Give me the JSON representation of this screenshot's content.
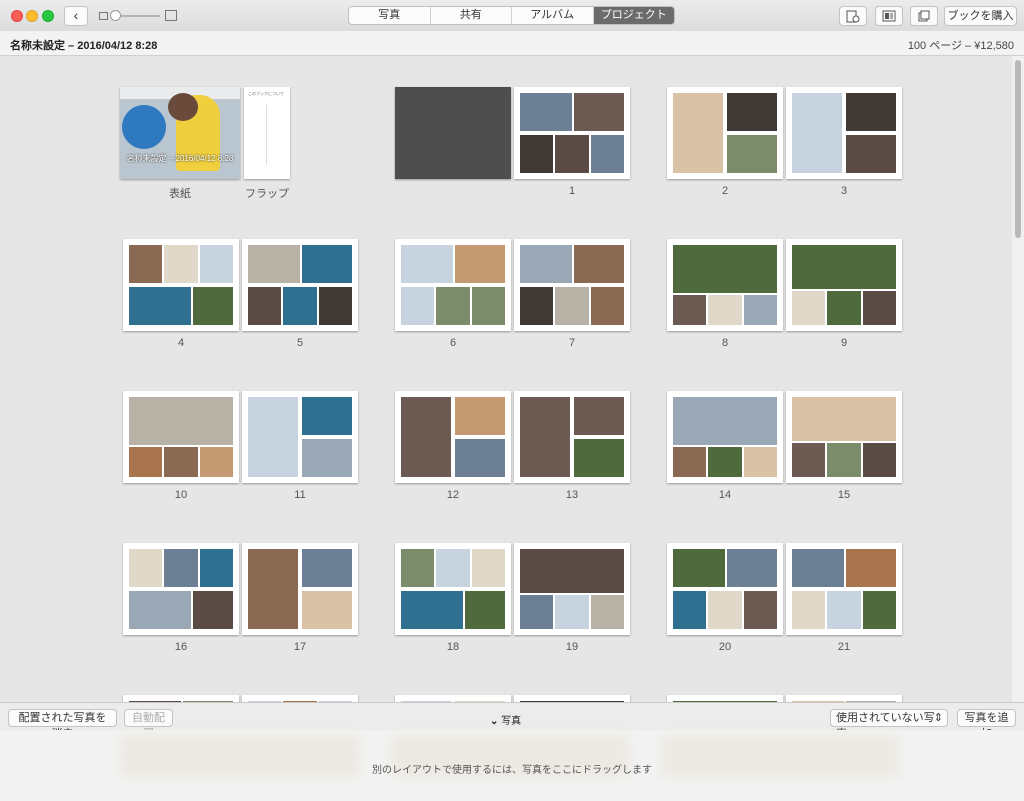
{
  "toolbar": {
    "tabs": [
      "写真",
      "共有",
      "アルバム",
      "プロジェクト"
    ],
    "active_tab": "プロジェクト",
    "buy_button": "ブックを購入"
  },
  "info": {
    "title": "名称未設定 – 2016/04/12 8:28",
    "summary": "100 ページ – ¥12,580"
  },
  "cover": {
    "caption": "名称未設定 – 2016/04/12 8:28",
    "flap_title": "このブックについて",
    "cover_label": "表紙",
    "flap_label": "フラップ"
  },
  "pages": [
    "1",
    "2",
    "3",
    "4",
    "5",
    "6",
    "7",
    "8",
    "9",
    "10",
    "11",
    "12",
    "13",
    "14",
    "15",
    "16",
    "17",
    "18",
    "19",
    "20",
    "21"
  ],
  "bottom": {
    "clear_button": "配置された写真を消去",
    "auto_button": "自動配置",
    "photos_toggle": "写真",
    "unused_select": "使用されていない写真",
    "add_button": "写真を追加",
    "drop_hint": "別のレイアウトで使用するには、写真をここにドラッグします"
  }
}
